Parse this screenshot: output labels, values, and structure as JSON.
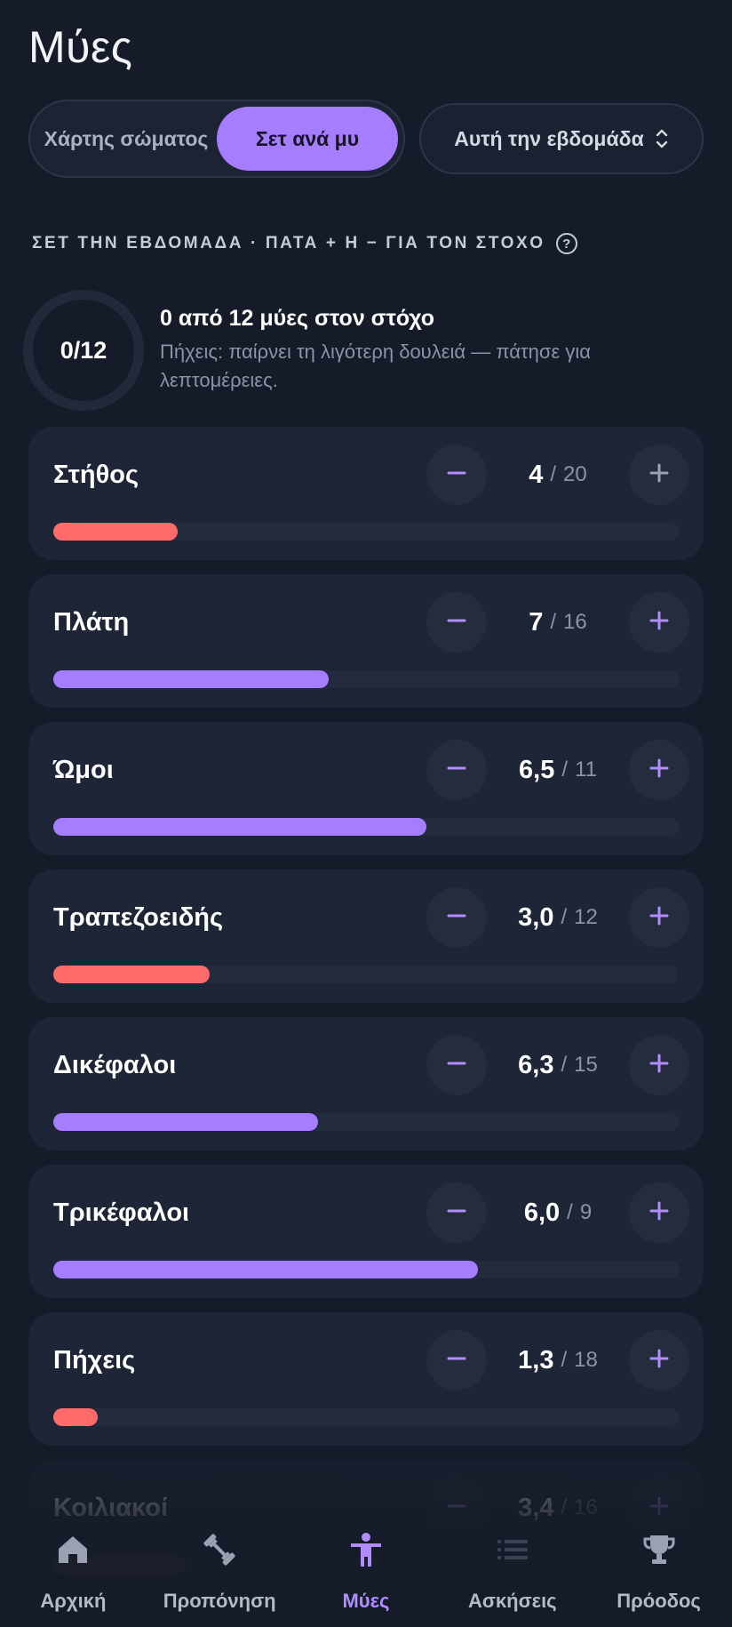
{
  "page": {
    "title": "Μύες"
  },
  "segmented": {
    "options": [
      "Χάρτης σώματος",
      "Σετ ανά μυ"
    ],
    "selected": "Σετ ανά μυ"
  },
  "period": {
    "label": "Αυτή την εβδομάδα"
  },
  "section": {
    "label": "ΣΕΤ ΤΗΝ ΕΒΔΟΜΑΔΑ · ΠΑΤΑ + Η − ΓΙΑ ΤΟΝ ΣΤΟΧΟ",
    "help_icon": "?"
  },
  "summary": {
    "ring_text": "0/12",
    "title": "0 από 12 μύες στον στόχο",
    "subtitle": "Πήχεις: παίρνει τη λιγότερη δουλειά — πάτησε για λεπτομέρειες."
  },
  "colors": {
    "under": "#ff6b6b",
    "ok": "#a57dff",
    "accent": "#b08cff"
  },
  "muscles": [
    {
      "name": "Στήθος",
      "current": "4",
      "target": "20",
      "progress": 0.2,
      "status": "under"
    },
    {
      "name": "Πλάτη",
      "current": "7",
      "target": "16",
      "progress": 0.44,
      "status": "ok"
    },
    {
      "name": "Ώμοι",
      "current": "6,5",
      "target": "11",
      "progress": 0.59,
      "status": "ok"
    },
    {
      "name": "Τραπεζοειδής",
      "current": "3,0",
      "target": "12",
      "progress": 0.25,
      "status": "under"
    },
    {
      "name": "Δικέφαλοι",
      "current": "6,3",
      "target": "15",
      "progress": 0.42,
      "status": "ok"
    },
    {
      "name": "Τρικέφαλοι",
      "current": "6,0",
      "target": "9",
      "progress": 0.67,
      "status": "ok"
    },
    {
      "name": "Πήχεις",
      "current": "1,3",
      "target": "18",
      "progress": 0.07,
      "status": "under"
    },
    {
      "name": "Κοιλιακοί",
      "current": "3,4",
      "target": "16",
      "progress": 0.21,
      "status": "under"
    }
  ],
  "stepper": {
    "slash": "/"
  },
  "nav": [
    {
      "label": "Αρχική",
      "icon": "home-icon",
      "active": false
    },
    {
      "label": "Προπόνηση",
      "icon": "dumbbell-icon",
      "active": false
    },
    {
      "label": "Μύες",
      "icon": "person-icon",
      "active": true
    },
    {
      "label": "Ασκήσεις",
      "icon": "list-icon",
      "active": false
    },
    {
      "label": "Πρόοδος",
      "icon": "trophy-icon",
      "active": false
    }
  ]
}
